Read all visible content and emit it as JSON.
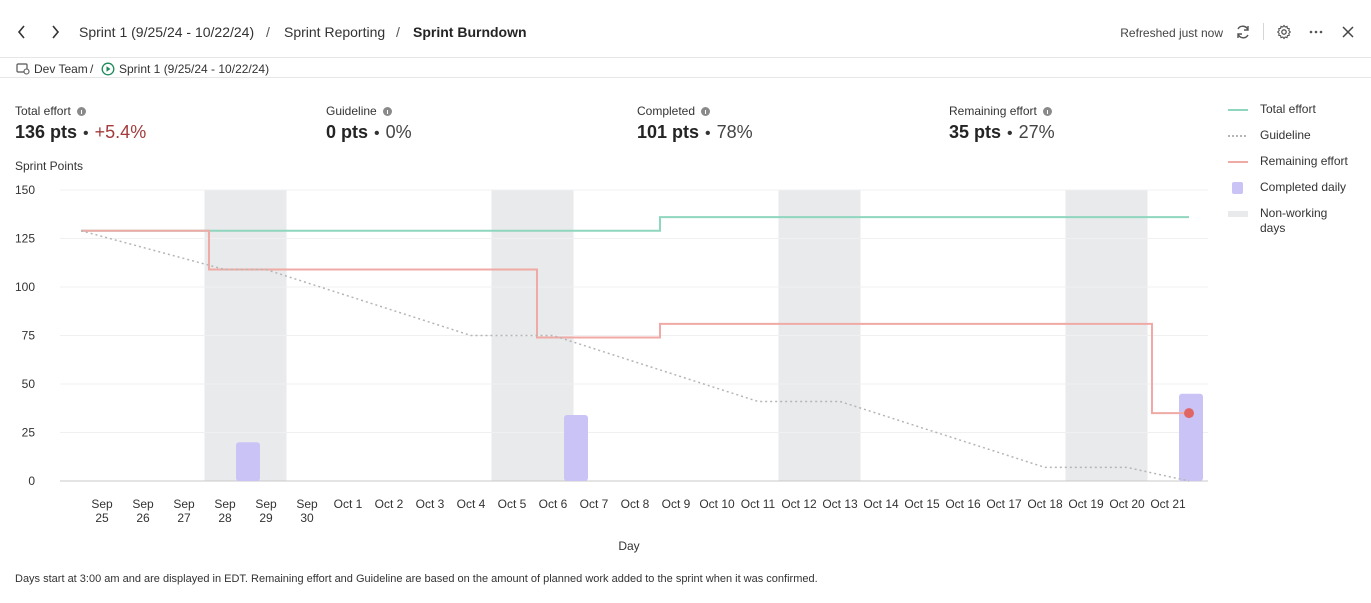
{
  "header": {
    "back_icon": "chevron-left-icon",
    "forward_icon": "chevron-right-icon",
    "breadcrumb": [
      "Sprint 1 (9/25/24 - 10/22/24)",
      "Sprint Reporting",
      "Sprint Burndown"
    ],
    "separator": "/",
    "refresh_text": "Refreshed just now",
    "icons": [
      "refresh-icon",
      "gear-icon",
      "more-icon",
      "close-icon"
    ]
  },
  "subbar": {
    "team": "Dev Team",
    "team_sep": "/",
    "sprint": "Sprint 1 (9/25/24 - 10/22/24)"
  },
  "stats": [
    {
      "label": "Total effort",
      "value": "136 pts",
      "sep": "•",
      "pct": "+5.4%"
    },
    {
      "label": "Guideline",
      "value": "0 pts",
      "sep": "•",
      "pct": "0%"
    },
    {
      "label": "Completed",
      "value": "101 pts",
      "sep": "•",
      "pct": "78%"
    },
    {
      "label": "Remaining effort",
      "value": "35 pts",
      "sep": "•",
      "pct": "27%"
    }
  ],
  "legend": [
    {
      "label": "Total effort",
      "color": "#8fd6bf"
    },
    {
      "label": "Guideline",
      "color": "#b5b5b5"
    },
    {
      "label": "Remaining effort",
      "color": "#f0aaa5"
    },
    {
      "label": "Completed daily",
      "color": "#c9c3f6"
    },
    {
      "label": "Non-working days",
      "color": "#e9eaec"
    }
  ],
  "footnote": "Days start at 3:00 am and are displayed in EDT. Remaining effort and Guideline are based on the amount of planned work added to the sprint when it was confirmed.",
  "chart_data": {
    "type": "line",
    "ylabel": "Sprint Points",
    "xlabel": "Day",
    "ylim": [
      0,
      150
    ],
    "yticks": [
      0,
      25,
      50,
      75,
      100,
      125,
      150
    ],
    "grid": true,
    "legend_position": "right",
    "categories": [
      "Sep 25",
      "Sep 26",
      "Sep 27",
      "Sep 28",
      "Sep 29",
      "Sep 30",
      "Oct 1",
      "Oct 2",
      "Oct 3",
      "Oct 4",
      "Oct 5",
      "Oct 6",
      "Oct 7",
      "Oct 8",
      "Oct 9",
      "Oct 10",
      "Oct 11",
      "Oct 12",
      "Oct 13",
      "Oct 14",
      "Oct 15",
      "Oct 16",
      "Oct 17",
      "Oct 18",
      "Oct 19",
      "Oct 20",
      "Oct 21"
    ],
    "non_working_days": [
      "Sep 28",
      "Sep 29",
      "Oct 5",
      "Oct 6",
      "Oct 12",
      "Oct 13",
      "Oct 19",
      "Oct 20"
    ],
    "series": [
      {
        "name": "Total effort",
        "style": "step",
        "color": "#8fd6bf",
        "values": [
          129,
          129,
          129,
          129,
          129,
          129,
          129,
          129,
          129,
          129,
          129,
          129,
          129,
          129,
          136,
          136,
          136,
          136,
          136,
          136,
          136,
          136,
          136,
          136,
          136,
          136,
          136
        ]
      },
      {
        "name": "Guideline",
        "style": "dotted",
        "color": "#b5b5b5",
        "points": [
          [
            "Sep 25",
            129
          ],
          [
            "Sep 28",
            109
          ],
          [
            "Sep 29",
            109
          ],
          [
            "Oct 4",
            75
          ],
          [
            "Oct 6",
            75
          ],
          [
            "Oct 11",
            41
          ],
          [
            "Oct 13",
            41
          ],
          [
            "Oct 18",
            7
          ],
          [
            "Oct 20",
            7
          ],
          [
            "Oct 21",
            0
          ]
        ]
      },
      {
        "name": "Remaining effort",
        "style": "step",
        "color": "#f0aaa5",
        "values": [
          129,
          129,
          129,
          109,
          109,
          109,
          109,
          109,
          109,
          109,
          109,
          74,
          74,
          74,
          81,
          81,
          81,
          81,
          81,
          81,
          81,
          81,
          81,
          81,
          81,
          81,
          35
        ]
      },
      {
        "name": "Completed daily",
        "style": "bar",
        "color": "#c9c3f6",
        "values": [
          0,
          0,
          0,
          20,
          0,
          0,
          0,
          0,
          0,
          0,
          0,
          34,
          0,
          0,
          0,
          0,
          0,
          0,
          0,
          0,
          0,
          0,
          0,
          0,
          0,
          0,
          45
        ]
      }
    ],
    "current_marker": {
      "x": "Oct 21",
      "y": 35,
      "color": "#e06666"
    }
  }
}
